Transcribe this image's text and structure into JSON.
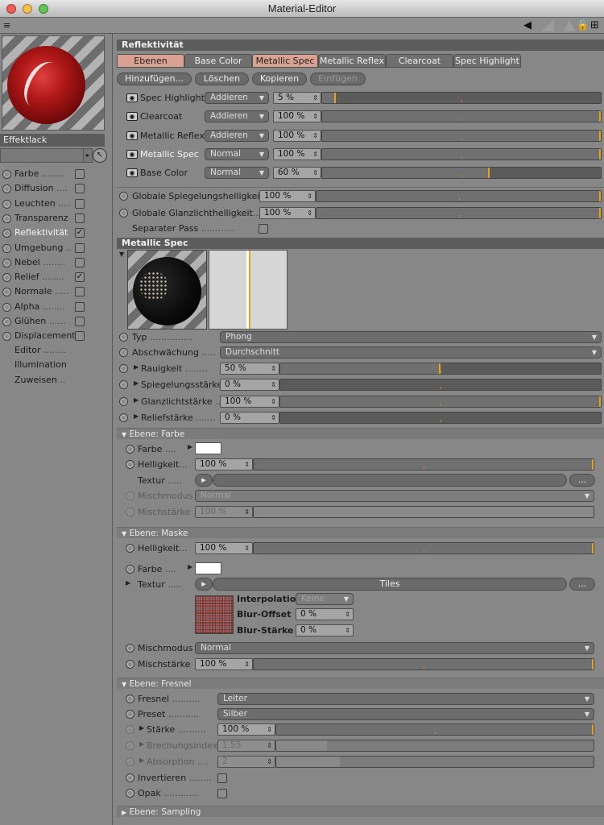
{
  "window": {
    "title": "Material-Editor"
  },
  "toolbar": {
    "left_icon": "≡",
    "arrow_icon": "◀",
    "lock_icon": "🔓",
    "add_icon": "⊞"
  },
  "sidebar": {
    "search_value": "Effektlack",
    "channels": [
      {
        "label": "Farbe",
        "dots": "........",
        "checked": false
      },
      {
        "label": "Diffusion",
        "dots": "....",
        "checked": false
      },
      {
        "label": "Leuchten",
        "dots": "....",
        "checked": false
      },
      {
        "label": "Transparenz",
        "dots": "",
        "checked": false
      },
      {
        "label": "Reflektivität",
        "dots": "",
        "checked": true
      },
      {
        "label": "Umgebung",
        "dots": "..",
        "checked": false
      },
      {
        "label": "Nebel",
        "dots": "........",
        "checked": false
      },
      {
        "label": "Relief",
        "dots": "........",
        "checked": true
      },
      {
        "label": "Normale",
        "dots": ".....",
        "checked": false
      },
      {
        "label": "Alpha",
        "dots": "........",
        "checked": false
      },
      {
        "label": "Glühen",
        "dots": "......",
        "checked": false
      },
      {
        "label": "Displacement",
        "dots": "",
        "checked": false
      }
    ],
    "extras": [
      {
        "label": "Editor",
        "dots": "........"
      },
      {
        "label": "Illumination",
        "dots": ""
      },
      {
        "label": "Zuweisen",
        "dots": ".."
      }
    ]
  },
  "reflect": {
    "header": "Reflektivität",
    "tabs": [
      "Ebenen",
      "Base Color",
      "Metallic Spec",
      "Metallic Reflex",
      "Clearcoat",
      "Spec Highlight"
    ],
    "buttons": [
      "Hinzufügen...",
      "Löschen",
      "Kopieren",
      "Einfügen"
    ],
    "layers": [
      {
        "name": "Spec Highlight",
        "mode": "Addieren",
        "value": "5 %",
        "fraction": 0.05
      },
      {
        "name": "Clearcoat",
        "mode": "Addieren",
        "value": "100 %",
        "fraction": 1.0
      },
      {
        "name": "Metallic Reflex",
        "mode": "Addieren",
        "value": "100 %",
        "fraction": 1.0
      },
      {
        "name": "Metallic Spec",
        "mode": "Normal",
        "value": "100 %",
        "fraction": 1.0
      },
      {
        "name": "Base Color",
        "mode": "Normal",
        "value": "60 %",
        "fraction": 0.6
      }
    ],
    "global_spec_label": "Globale Spiegelungshelligkeit",
    "global_spec_value": "100 %",
    "global_spec_fraction": 1.0,
    "global_gloss_label": "Globale Glanzlichthelligkeit",
    "global_gloss_dots": "..",
    "global_gloss_value": "100 %",
    "global_gloss_fraction": 1.0,
    "separate_pass_label": "Separater Pass",
    "separate_pass_dots": "............"
  },
  "metallic": {
    "header": "Metallic Spec",
    "typ_label": "Typ",
    "typ_dots": "...............",
    "typ_value": "Phong",
    "atten_label": "Abschwächung",
    "atten_dots": ".....",
    "atten_value": "Durchschnitt",
    "rough_label": "Rauigkeit",
    "rough_dots": "........",
    "rough_value": "50 %",
    "rough_fraction": 0.5,
    "specstr_label": "Spiegelungsstärke",
    "specstr_value": "0 %",
    "specstr_fraction": 0.0,
    "gloss_label": "Glanzlichtstärke",
    "gloss_dots": "...",
    "gloss_value": "100 %",
    "gloss_fraction": 1.0,
    "relief_label": "Reliefstärke",
    "relief_dots": ".......",
    "relief_value": "0 %",
    "relief_fraction": 0.0
  },
  "farbe": {
    "header": "Ebene: Farbe",
    "farbe_label": "Farbe",
    "farbe_dots": "....",
    "swatch": "#ffffff",
    "hell_label": "Helligkeit",
    "hell_dots": "...",
    "hell_value": "100 %",
    "hell_fraction": 1.0,
    "textur_label": "Textur",
    "textur_dots": ".....",
    "more": "...",
    "misch_label": "Mischmodus",
    "misch_dots": "..",
    "misch_value": "Normal",
    "mischst_label": "Mischstärke",
    "mischst_dots": "..",
    "mischst_value": "100 %"
  },
  "maske": {
    "header": "Ebene: Maske",
    "hell_label": "Helligkeit",
    "hell_dots": "...",
    "hell_value": "100 %",
    "hell_fraction": 1.0,
    "farbe_label": "Farbe",
    "farbe_dots": "....",
    "swatch": "#ffffff",
    "textur_label": "Textur",
    "textur_dots": ".....",
    "textur_value": "Tiles",
    "more": "...",
    "interp_label": "Interpolation",
    "interp_value": "Keine",
    "bluroff_label": "Blur-Offset",
    "bluroff_value": "0 %",
    "blurst_label": "Blur-Stärke",
    "blurst_value": "0 %",
    "misch_label": "Mischmodus",
    "misch_value": "Normal",
    "mischst_label": "Mischstärke",
    "mischst_value": "100 %",
    "mischst_fraction": 1.0
  },
  "fresnel": {
    "header": "Ebene: Fresnel",
    "fresnel_label": "Fresnel",
    "fresnel_dots": "..........",
    "fresnel_value": "Leiter",
    "preset_label": "Preset",
    "preset_dots": "...........",
    "preset_value": "Silber",
    "staerke_label": "Stärke",
    "staerke_dots": "..........",
    "staerke_value": "100 %",
    "staerke_fraction": 1.0,
    "brech_label": "Brechungsindex",
    "brech_value": "1.55",
    "absorp_label": "Absorption",
    "absorp_dots": "....",
    "absorp_value": "2",
    "invert_label": "Invertieren",
    "invert_dots": "........",
    "opak_label": "Opak",
    "opak_dots": "............"
  },
  "sampling": {
    "header": "Ebene: Sampling"
  },
  "colors": {
    "accent": "#e8a21b",
    "tab_highlight": "#d8a191",
    "section": "#5c5c5c",
    "panel": "#878787"
  }
}
